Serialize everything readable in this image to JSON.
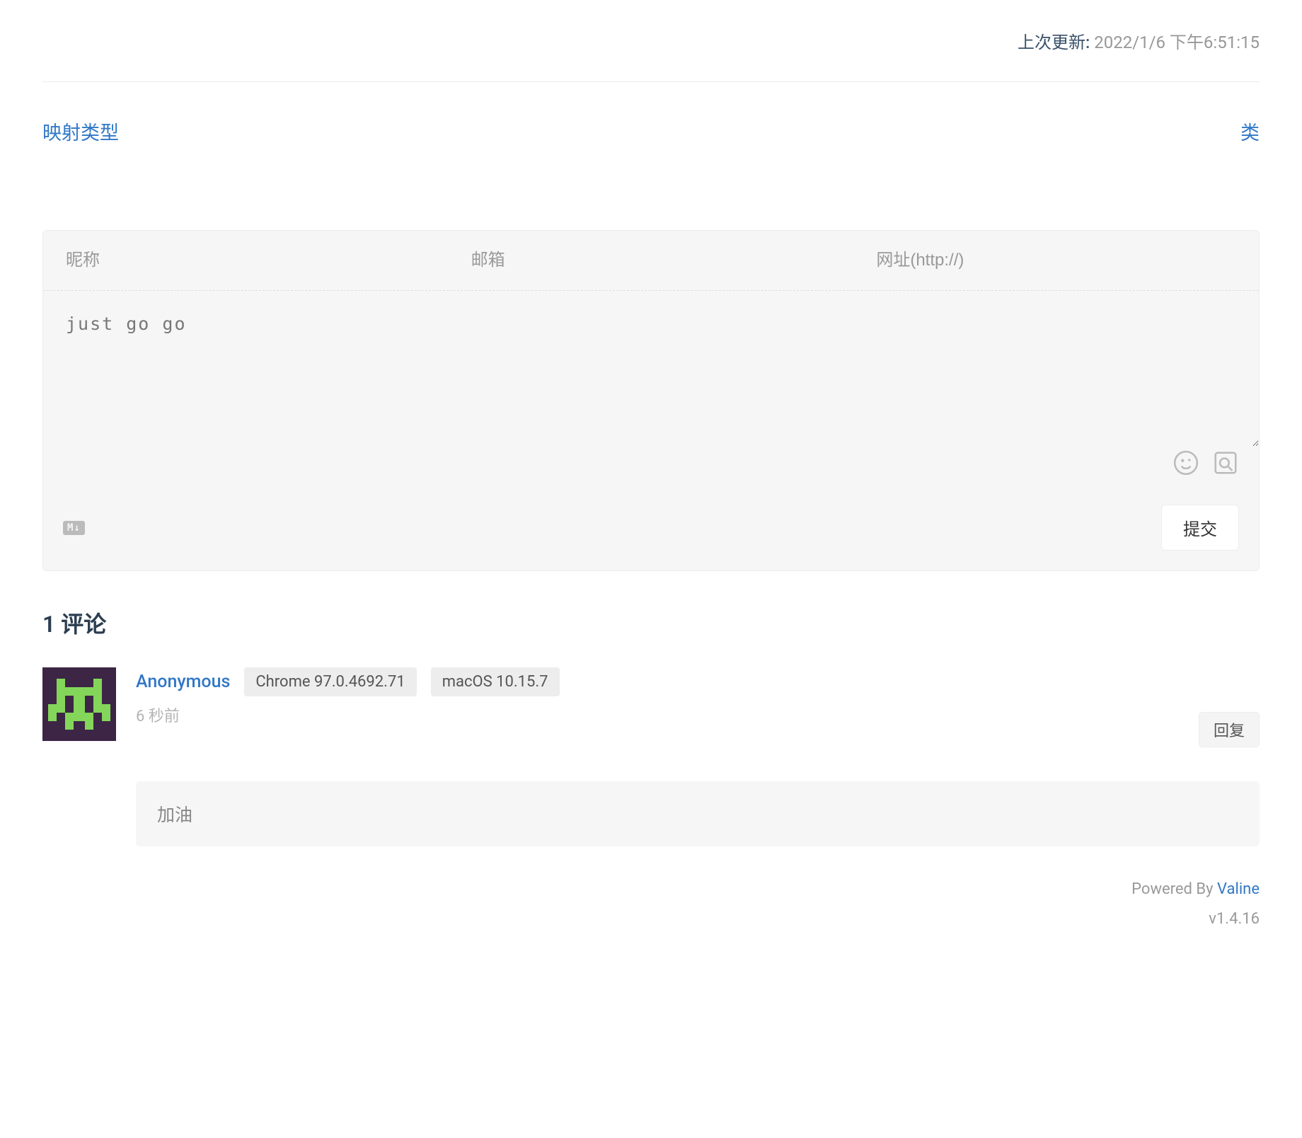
{
  "header": {
    "last_updated_label": "上次更新:",
    "last_updated_time": "2022/1/6 下午6:51:15"
  },
  "nav": {
    "prev": "映射类型",
    "next": "类"
  },
  "form": {
    "nickname_placeholder": "昵称",
    "email_placeholder": "邮箱",
    "url_placeholder": "网址(http://)",
    "comment_placeholder": "just go go",
    "markdown_badge": "M↓",
    "submit_label": "提交"
  },
  "comments": {
    "count": "1",
    "heading_suffix": "评论",
    "items": [
      {
        "author": "Anonymous",
        "browser": "Chrome 97.0.4692.71",
        "os": "macOS 10.15.7",
        "time": "6 秒前",
        "reply_label": "回复",
        "content": "加油"
      }
    ]
  },
  "footer": {
    "powered_by_prefix": "Powered By ",
    "powered_by_link": "Valine",
    "version": "v1.4.16"
  }
}
